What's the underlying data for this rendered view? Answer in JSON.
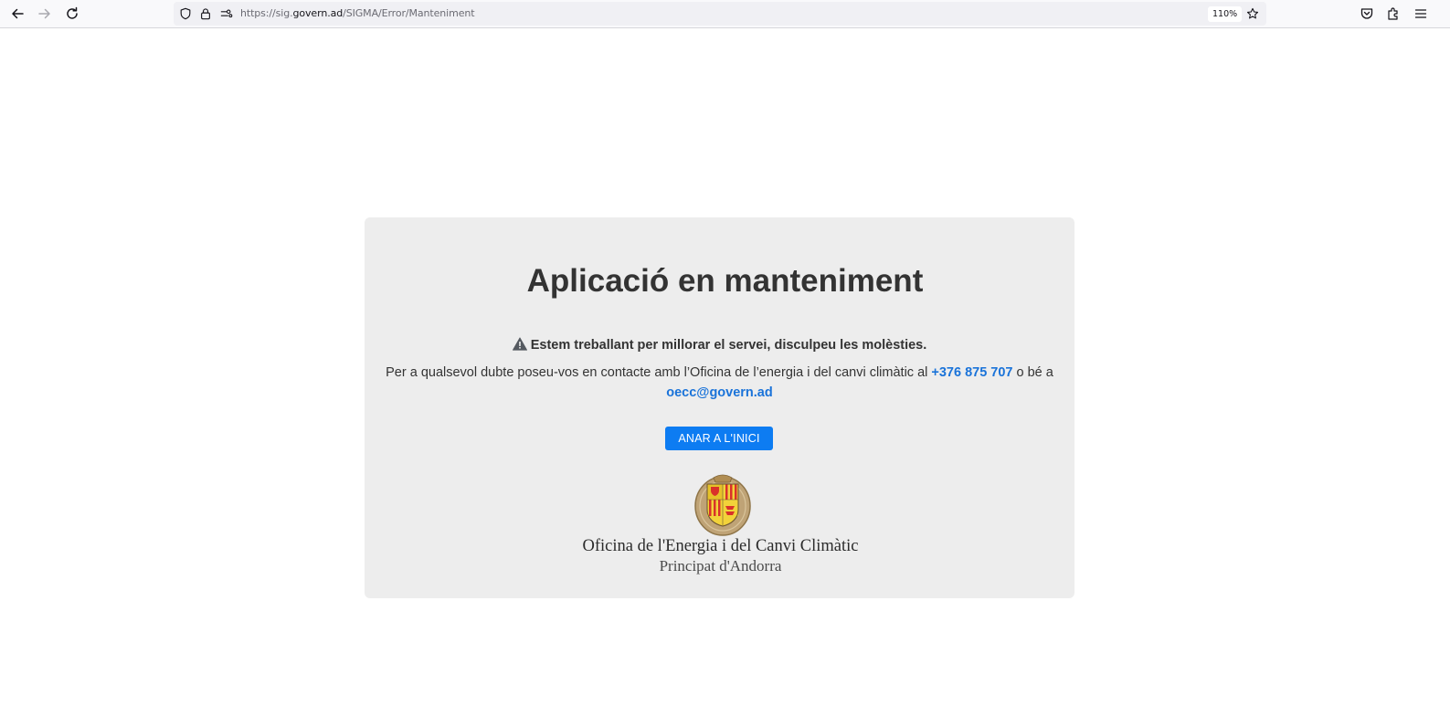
{
  "browser": {
    "url_prefix": "https://sig.",
    "url_host": "govern.ad",
    "url_path": "/SIGMA/Error/Manteniment",
    "zoom": "110%"
  },
  "page": {
    "title": "Aplicació en manteniment",
    "warning": "Estem treballant per millorar el servei, disculpeu les molèsties.",
    "contact_before": "Per a qualsevol dubte poseu-vos en contacte amb l’Oficina de l’energia i del canvi climàtic al ",
    "phone": "+376 875 707",
    "contact_middle": " o bé a ",
    "email": "oecc@govern.ad",
    "home_button": "ANAR A L'INICI",
    "org_name": "Oficina de l'Energia i del Canvi Climàtic",
    "org_subtitle": "Principat d'Andorra"
  },
  "colors": {
    "card_bg": "#ededed",
    "accent": "#0d7cf2",
    "link": "#1a73d9"
  }
}
